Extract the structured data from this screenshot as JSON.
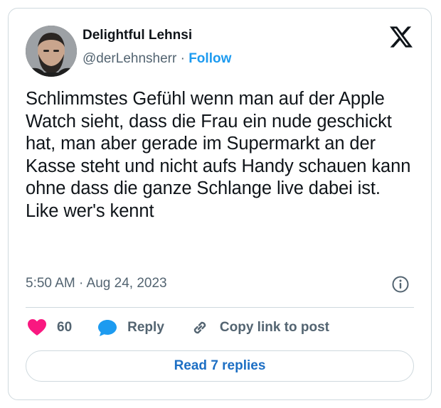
{
  "author": {
    "display_name": "Delightful Lehnsi",
    "handle": "@derLehnsherr",
    "separator": "·",
    "follow_label": "Follow"
  },
  "logo_icon": "x-logo-icon",
  "tweet": {
    "text": "Schlimmstes Gefühl wenn man auf der Apple Watch sieht, dass die Frau ein nude geschickt hat, man aber gerade im Supermarkt an der Kasse steht und nicht aufs Handy schauen kann ohne dass die ganze Schlange live dabei ist. Like wer's kennt",
    "timestamp": "5:50 AM · Aug 24, 2023"
  },
  "actions": {
    "like_count": "60",
    "reply_label": "Reply",
    "copy_link_label": "Copy link to post"
  },
  "read_replies_label": "Read 7 replies",
  "colors": {
    "accent": "#1d9bf0",
    "like": "#f91880",
    "text": "#0f1419",
    "muted": "#536471",
    "border": "#cfd9de"
  }
}
